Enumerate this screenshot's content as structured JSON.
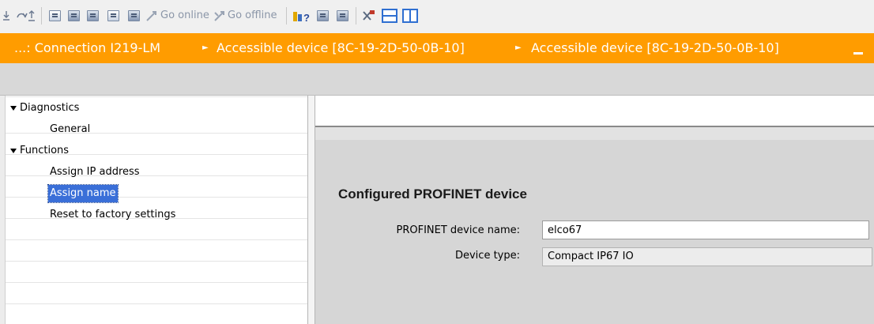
{
  "toolbar": {
    "go_online_label": "Go online",
    "go_offline_label": "Go offline",
    "icons": [
      "download-icon",
      "upload-icon",
      "compile-icon",
      "monitor-icon",
      "runtime-icon",
      "go-online-icon",
      "go-offline-icon",
      "accessible-devices-icon",
      "start-simulation-icon",
      "stop-simulation-icon",
      "cross-reference-icon",
      "split-horizontal-icon",
      "split-vertical-icon"
    ]
  },
  "breadcrumb": {
    "items": [
      "...: Connection I219-LM",
      "Accessible device [8C-19-2D-50-0B-10]",
      "Accessible device [8C-19-2D-50-0B-10]"
    ],
    "separator": "►",
    "color": "#ff9c00"
  },
  "tree": {
    "items": [
      {
        "label": "Diagnostics",
        "level": 0,
        "expanded": true
      },
      {
        "label": "General",
        "level": 1
      },
      {
        "label": "Functions",
        "level": 0,
        "expanded": true
      },
      {
        "label": "Assign IP address",
        "level": 1
      },
      {
        "label": "Assign name",
        "level": 1,
        "selected": true
      },
      {
        "label": "Reset to factory settings",
        "level": 1
      }
    ]
  },
  "section": {
    "title": "Configured PROFINET device",
    "fields": [
      {
        "label": "PROFINET device name:",
        "value": "elco67",
        "editable": true
      },
      {
        "label": "Device type:",
        "value": "Compact IP67 IO",
        "editable": false
      }
    ]
  }
}
